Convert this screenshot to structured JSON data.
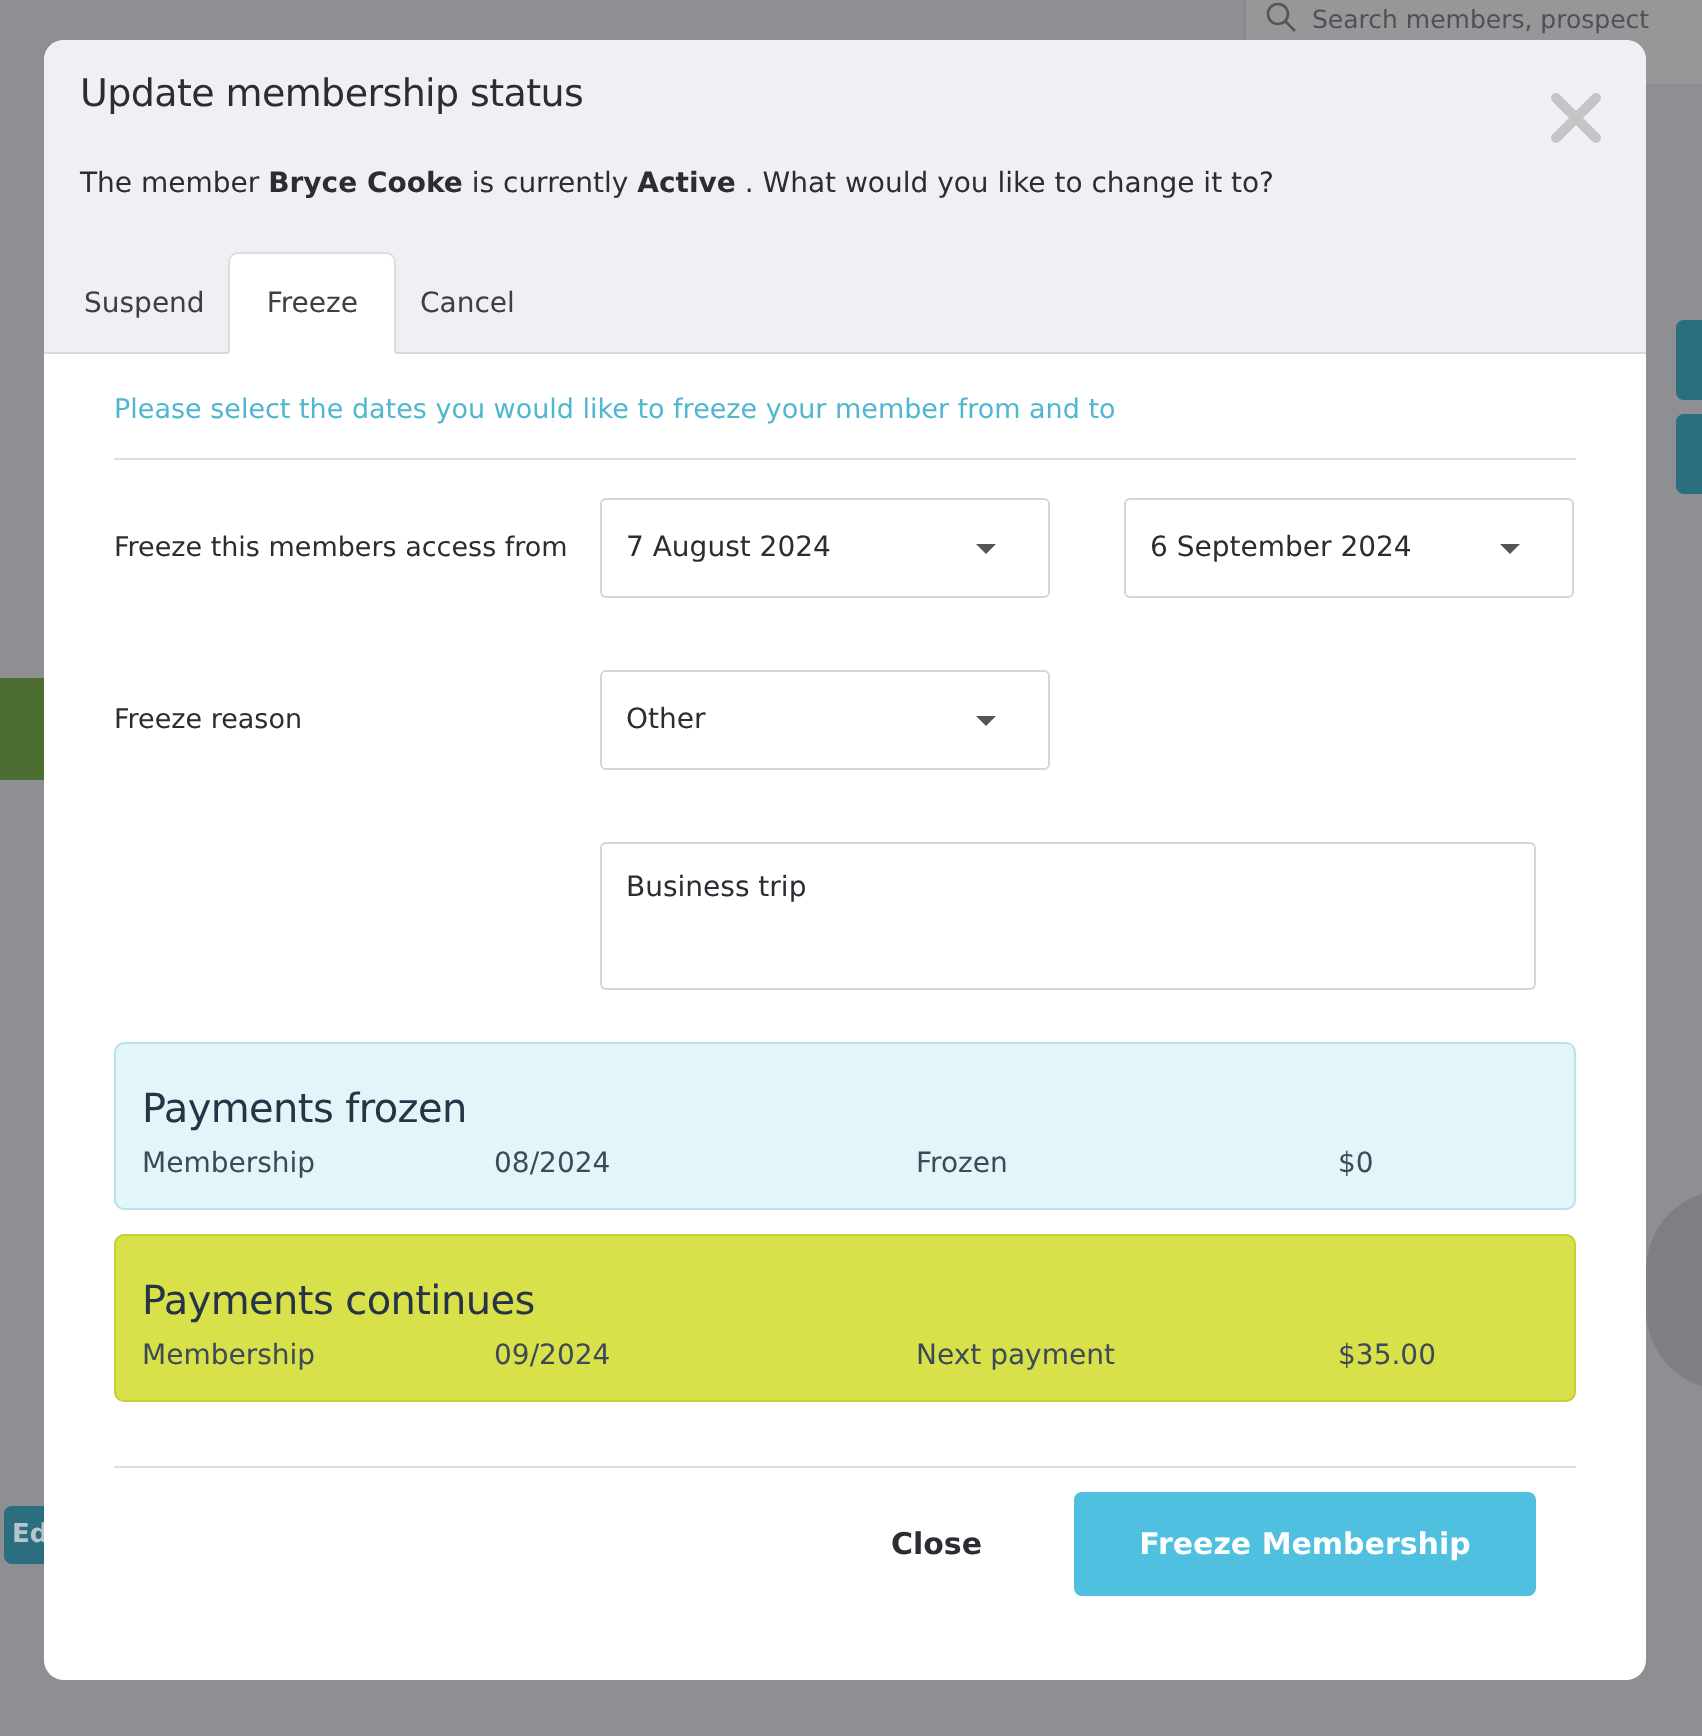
{
  "background": {
    "search": {
      "placeholder": "Search members, prospect"
    },
    "edit_button": "Ed"
  },
  "dialog": {
    "title": "Update membership status",
    "message": "The member **Bryce Cooke** is currently **Active** . What would you like to change it to?",
    "tabs": [
      {
        "label": "Suspend",
        "selected": false
      },
      {
        "label": "Freeze",
        "selected": true
      },
      {
        "label": "Cancel",
        "selected": false
      }
    ],
    "instruction": "Please select the dates you would like to freeze your member from and to",
    "access_from": {
      "label": "Freeze this members access from",
      "from": "7 August 2024",
      "to": "6 September 2024"
    },
    "reason": {
      "label": "Freeze reason",
      "value": "Other",
      "note": "Business trip"
    },
    "summaries": [
      {
        "kind": "frozen",
        "title": "Payments frozen",
        "item": "Membership",
        "period": "08/2024",
        "status": "Frozen",
        "amount": "$0"
      },
      {
        "kind": "continues",
        "title": "Payments continues",
        "item": "Membership",
        "period": "09/2024",
        "status": "Next payment",
        "amount": "$35.00"
      }
    ],
    "buttons": [
      {
        "kind": "plain",
        "label": "Close"
      },
      {
        "kind": "primary",
        "label": "Freeze Membership"
      }
    ]
  }
}
